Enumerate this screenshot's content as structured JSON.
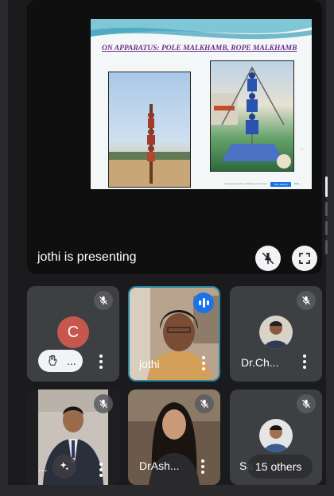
{
  "slide": {
    "title": "ON APPARATUS: POLE MALKHAMB, ROPE MALKHAMB",
    "footer": {
      "share_text": "meet.google.com is sharing your screen.",
      "stop_label": "Stop sharing",
      "hide_label": "Hide"
    }
  },
  "stage": {
    "presenting_text": "jothi is presenting"
  },
  "tiles": [
    {
      "id": "c",
      "avatar_letter": "C",
      "hand_label": "..."
    },
    {
      "id": "jothi",
      "name": "jothi"
    },
    {
      "id": "drch",
      "name": "Dr.Ch..."
    },
    {
      "id": "man",
      "name": "..."
    },
    {
      "id": "drash",
      "name": "DrAsh..."
    },
    {
      "id": "others",
      "name_fragment": "Sa",
      "others_label": "15 others"
    }
  ],
  "colors": {
    "background": "#1b1b1d",
    "tile": "#3c4043",
    "active_border": "#2b8aa5",
    "speaking_blue": "#1a73e8",
    "avatar_c": "#c7574d"
  },
  "icons": [
    "mic-off-icon",
    "pin-off-icon",
    "fullscreen-icon",
    "raised-hand-icon",
    "more-vert-icon",
    "speaking-indicator-icon",
    "visual-effects-icon"
  ]
}
